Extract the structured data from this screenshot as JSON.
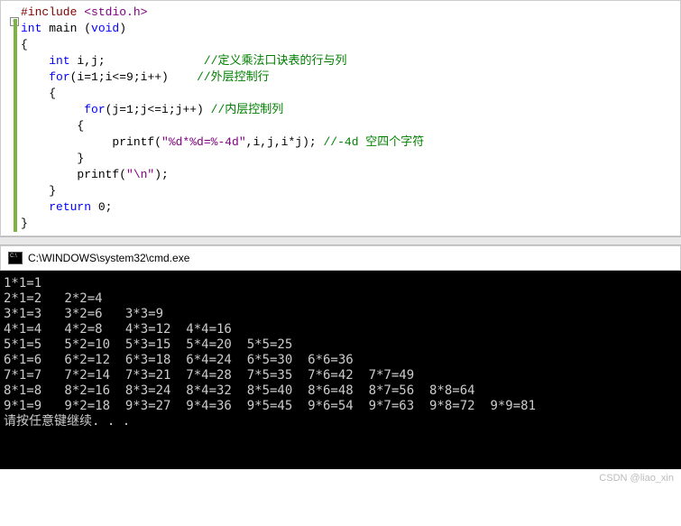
{
  "code": {
    "l1_pre": "#include",
    "l1_inc": "<stdio.h>",
    "l2_type1": "int",
    "l2_func": " main (",
    "l2_type2": "void",
    "l2_close": ")",
    "l3": "{",
    "l4_indent": "    ",
    "l4_type": "int",
    "l4_rest": " i,j;              ",
    "l4_comment": "//定义乘法口诀表的行与列",
    "l5_indent": "    ",
    "l5_kw": "for",
    "l5_rest": "(i=1;i<=9;i++)    ",
    "l5_comment": "//外层控制行",
    "l6": "    {",
    "l7_indent": "         ",
    "l7_kw": "for",
    "l7_rest": "(j=1;j<=i;j++) ",
    "l7_comment": "//内层控制列",
    "l8": "        {",
    "l9_indent": "             printf(",
    "l9_str": "\"%d*%d=%-4d\"",
    "l9_mid": ",i,j,i*j); ",
    "l9_comment": "//-4d 空四个字符",
    "l10": "        }",
    "l11_indent": "        printf(",
    "l11_str": "\"\\n\"",
    "l11_close": ");",
    "l12": "    }",
    "l13_indent": "    ",
    "l13_kw": "return",
    "l13_rest": " 0;",
    "l14": "}"
  },
  "console": {
    "title": "C:\\WINDOWS\\system32\\cmd.exe",
    "lines": [
      "1*1=1",
      "2*1=2   2*2=4",
      "3*1=3   3*2=6   3*3=9",
      "4*1=4   4*2=8   4*3=12  4*4=16",
      "5*1=5   5*2=10  5*3=15  5*4=20  5*5=25",
      "6*1=6   6*2=12  6*3=18  6*4=24  6*5=30  6*6=36",
      "7*1=7   7*2=14  7*3=21  7*4=28  7*5=35  7*6=42  7*7=49",
      "8*1=8   8*2=16  8*3=24  8*4=32  8*5=40  8*6=48  8*7=56  8*8=64",
      "9*1=9   9*2=18  9*3=27  9*4=36  9*5=45  9*6=54  9*7=63  9*8=72  9*9=81",
      "请按任意键继续. . ."
    ]
  },
  "watermark": "CSDN @liao_xin",
  "fold_symbol": "−"
}
